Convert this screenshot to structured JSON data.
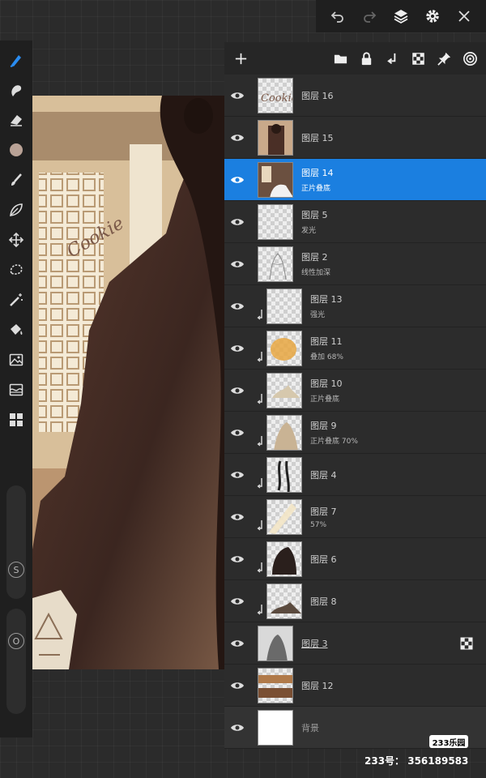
{
  "layers": [
    {
      "name": "图层 16",
      "sub": ""
    },
    {
      "name": "图层 15",
      "sub": ""
    },
    {
      "name": "图层 14",
      "sub": "正片叠底"
    },
    {
      "name": "图层 5",
      "sub": "发光"
    },
    {
      "name": "图层 2",
      "sub": "线性加深"
    },
    {
      "name": "图层 13",
      "sub": "强光"
    },
    {
      "name": "图层 11",
      "sub": "叠加  68%"
    },
    {
      "name": "图层 10",
      "sub": "正片叠底"
    },
    {
      "name": "图层 9",
      "sub": "正片叠底  70%"
    },
    {
      "name": "图层 4",
      "sub": ""
    },
    {
      "name": "图层 7",
      "sub": "57%"
    },
    {
      "name": "图层 6",
      "sub": ""
    },
    {
      "name": "图层 8",
      "sub": ""
    },
    {
      "name": "图层 3",
      "sub": ""
    },
    {
      "name": "图层 12",
      "sub": ""
    },
    {
      "name": "背景",
      "sub": ""
    }
  ],
  "artwork": {
    "signature": "Cookie"
  },
  "toolbar": {
    "slider_size_label": "S",
    "slider_opacity_label": "O"
  },
  "watermark": {
    "logo": "233乐园",
    "id_text": "233号： 356189583"
  },
  "colors": {
    "selected": "#1b7fe0",
    "current_color": "#b9a296"
  }
}
